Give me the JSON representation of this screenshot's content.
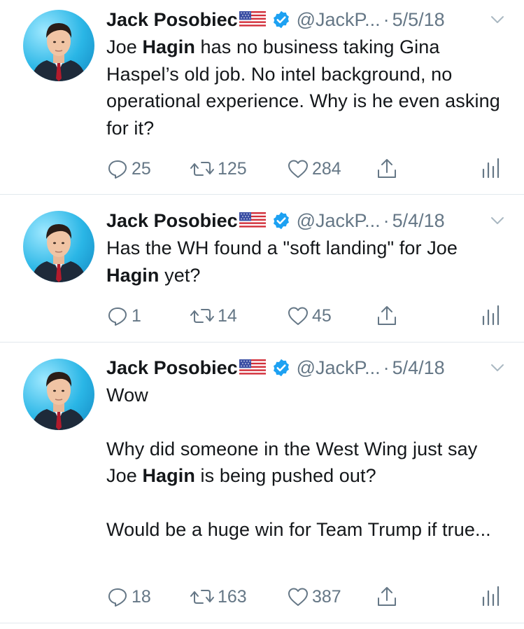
{
  "tweets": [
    {
      "author": "Jack Posobiec",
      "flag": "🇺🇸",
      "handle": "@JackP...",
      "separator": "·",
      "date": "5/5/18",
      "paragraphs": [
        [
          {
            "text": "Joe ",
            "bold": false
          },
          {
            "text": "Hagin",
            "bold": true
          },
          {
            "text": " has no business taking Gina Haspel’s old job. No intel background, no operational experience. Why is he even asking for it?",
            "bold": false
          }
        ]
      ],
      "replies": "25",
      "retweets": "125",
      "likes": "284"
    },
    {
      "author": "Jack Posobiec",
      "flag": "🇺🇸",
      "handle": "@JackP...",
      "separator": "·",
      "date": "5/4/18",
      "paragraphs": [
        [
          {
            "text": "Has the WH found a \"soft landing\" for Joe ",
            "bold": false
          },
          {
            "text": "Hagin",
            "bold": true
          },
          {
            "text": " yet?",
            "bold": false
          }
        ]
      ],
      "replies": "1",
      "retweets": "14",
      "likes": "45"
    },
    {
      "author": "Jack Posobiec",
      "flag": "🇺🇸",
      "handle": "@JackP...",
      "separator": "·",
      "date": "5/4/18",
      "paragraphs": [
        [
          {
            "text": "Wow",
            "bold": false
          }
        ],
        [
          {
            "text": "Why did someone in the West Wing just say Joe ",
            "bold": false
          },
          {
            "text": "Hagin",
            "bold": true
          },
          {
            "text": " is being pushed out?",
            "bold": false
          }
        ],
        [
          {
            "text": "Would be a huge win for Team Trump if true...",
            "bold": false
          }
        ]
      ],
      "replies": "18",
      "retweets": "163",
      "likes": "387"
    }
  ],
  "colors": {
    "text": "#14171a",
    "secondary": "#657786",
    "verified": "#1da1f2",
    "divider": "#e1e8ed"
  },
  "icons": [
    "verified-badge-icon",
    "caret-down-icon",
    "reply-icon",
    "retweet-icon",
    "like-icon",
    "share-icon",
    "analytics-icon",
    "us-flag-icon"
  ]
}
